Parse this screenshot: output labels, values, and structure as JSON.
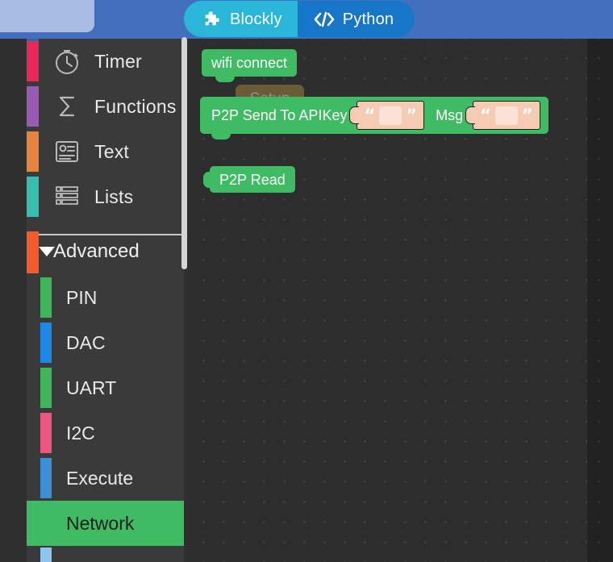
{
  "header": {
    "tabs": [
      {
        "id": "blockly",
        "label": "Blockly",
        "icon": "puzzle-piece-icon",
        "active": true,
        "bg": "#29b6d8"
      },
      {
        "id": "python",
        "label": "Python",
        "icon": "code-brackets-icon",
        "active": false,
        "bg": "#1876c9"
      }
    ],
    "bar_color": "#4270be",
    "left_panel_color": "#a9bde2"
  },
  "toolbox": {
    "background": "#3a3a3a",
    "items": [
      {
        "label": "",
        "chip": "#2d6aa8",
        "icon": "",
        "partial": true
      },
      {
        "label": "Timer",
        "chip": "#e8285a",
        "icon": "clock-icon"
      },
      {
        "label": "Functions",
        "chip": "#9b59b6",
        "icon": "sigma-icon"
      },
      {
        "label": "Text",
        "chip": "#e8833a",
        "icon": "text-card-icon"
      },
      {
        "label": "Lists",
        "chip": "#35bfb0",
        "icon": "list-icon"
      }
    ],
    "section": {
      "label": "Advanced",
      "chip": "#f45b2a",
      "caret": "caret-down-icon",
      "expanded": true,
      "items": [
        {
          "label": "PIN",
          "chip": "#3fb55c",
          "selected": false
        },
        {
          "label": "DAC",
          "chip": "#1e88e8",
          "selected": false
        },
        {
          "label": "UART",
          "chip": "#3fb55c",
          "selected": false
        },
        {
          "label": "I2C",
          "chip": "#ec5580",
          "selected": false
        },
        {
          "label": "Execute",
          "chip": "#3b8fd4",
          "selected": false
        },
        {
          "label": "Network",
          "chip": "#3fbc63",
          "selected": true
        },
        {
          "label": "",
          "chip": "#8ec5f0",
          "selected": false,
          "partial": true
        }
      ]
    },
    "selected_color": "#3fbc63",
    "scrollbar_color": "#d6d6d6"
  },
  "workspace": {
    "background": "#2d2d2d",
    "grid_dots": true,
    "blocks": [
      {
        "id": "wifi-connect",
        "label": "wifi connect",
        "type": "statement",
        "color": "#3fbc63"
      },
      {
        "id": "setup-ghost",
        "label": "Setup",
        "type": "ghost",
        "color": "#6b5c38"
      },
      {
        "id": "p2p-send",
        "label": "P2P Send To APIKey",
        "second_label": "Msg",
        "type": "statement",
        "color": "#3fbc63",
        "inputs": [
          {
            "id": "apikey",
            "type": "string",
            "value": "",
            "left_quote": "“",
            "right_quote": "”"
          },
          {
            "id": "msg",
            "type": "string",
            "value": "",
            "left_quote": "“",
            "right_quote": "”"
          }
        ]
      },
      {
        "id": "p2p-read",
        "label": "P2P Read",
        "type": "value",
        "color": "#3fbc63"
      }
    ]
  }
}
